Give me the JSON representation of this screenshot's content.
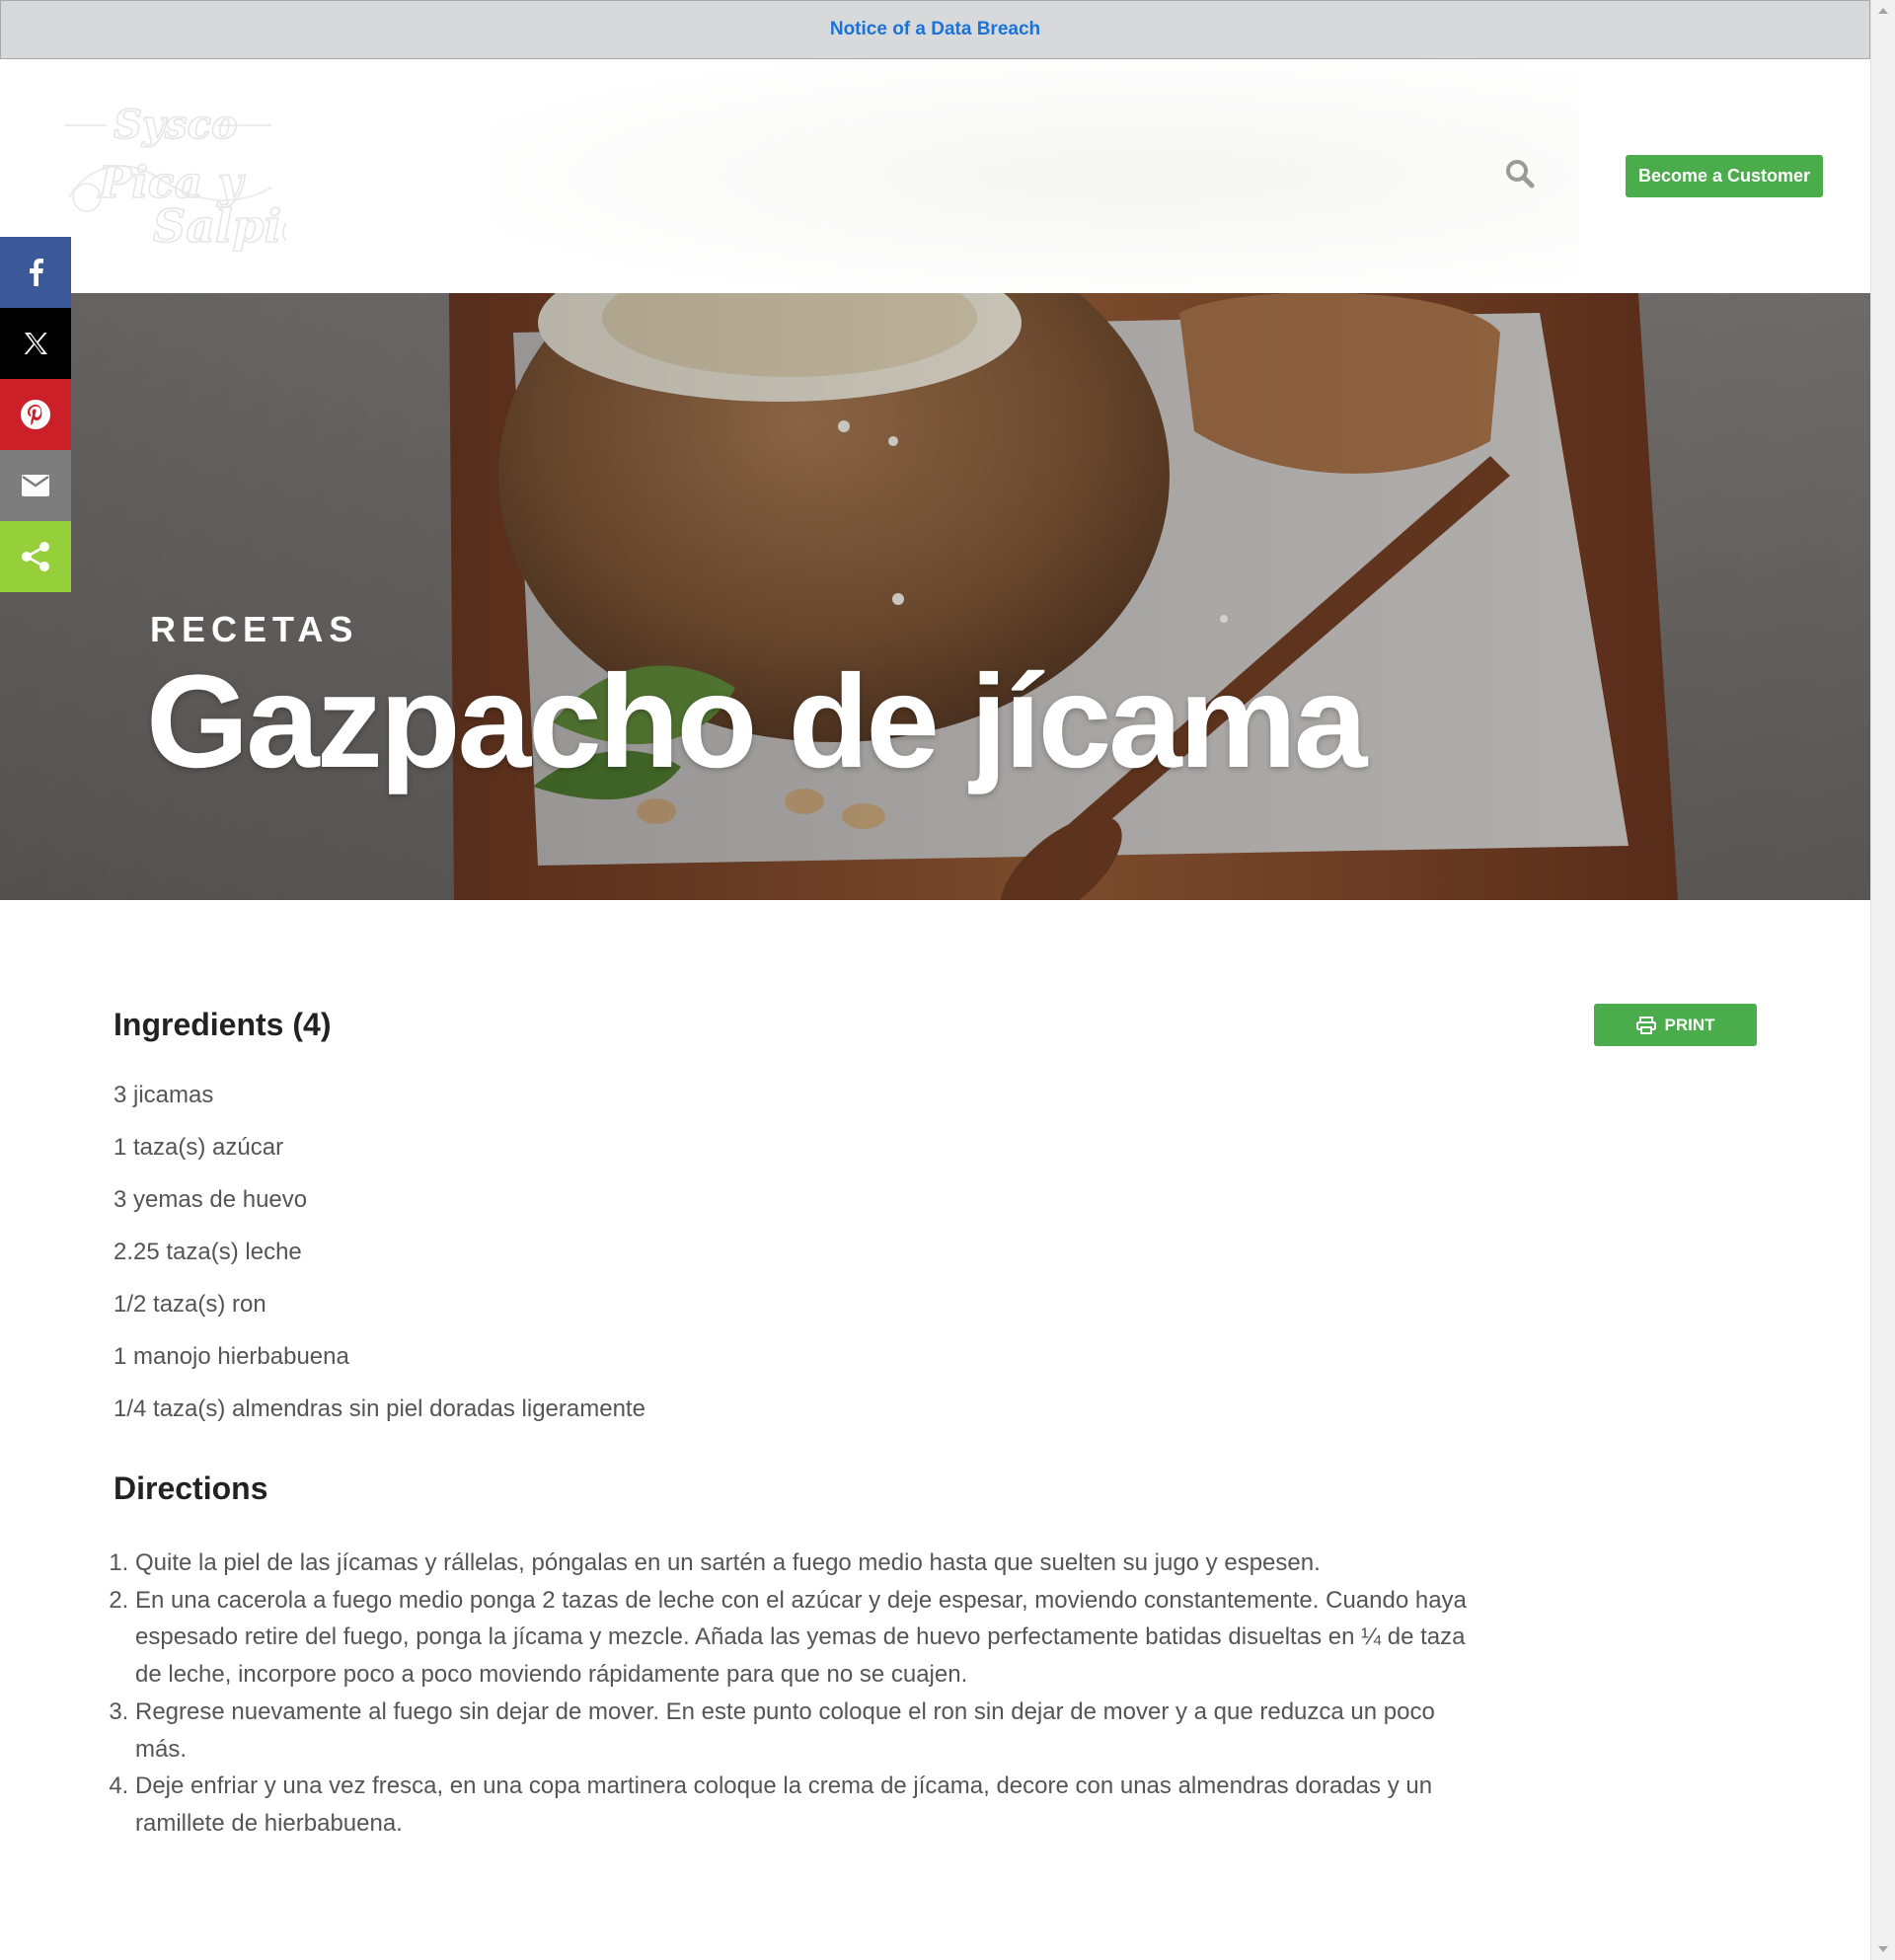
{
  "notice": {
    "link_text": "Notice of a Data Breach"
  },
  "header": {
    "logo_text_line1": "Sysco",
    "logo_text_line2": "Pica y",
    "logo_text_line3": "Salpica",
    "cta_label": "Become a Customer",
    "search_icon": "search-icon"
  },
  "share": {
    "items": [
      {
        "name": "facebook",
        "icon": "facebook-icon",
        "color": "#3b5998"
      },
      {
        "name": "x",
        "icon": "x-icon",
        "color": "#000000"
      },
      {
        "name": "pinterest",
        "icon": "pinterest-icon",
        "color": "#cb2027"
      },
      {
        "name": "email",
        "icon": "email-icon",
        "color": "#7d7d7d"
      },
      {
        "name": "share",
        "icon": "share-icon",
        "color": "#95d03a"
      }
    ]
  },
  "hero": {
    "kicker": "RECETAS",
    "title": "Gazpacho de jícama"
  },
  "recipe": {
    "ingredients_title": "Ingredients (4)",
    "print_label": "PRINT",
    "ingredients": [
      "3 jicamas",
      "1 taza(s) azúcar",
      "3 yemas de huevo",
      "2.25 taza(s) leche",
      "1/2 taza(s) ron",
      "1 manojo hierbabuena",
      "1/4 taza(s) almendras sin piel doradas ligeramente"
    ],
    "directions_title": "Directions",
    "directions": [
      "Quite la piel de las jícamas y rállelas, póngalas en un sartén a fuego medio hasta que suelten su jugo y espesen.",
      "En una cacerola a fuego medio ponga 2 tazas de leche con el azúcar y deje espesar, moviendo constantemente. Cuando haya espesado retire del fuego, ponga la jícama y mezcle. Añada las yemas de huevo perfectamente batidas disueltas en ¼ de taza de leche, incorpore poco a poco moviendo rápidamente para que no se cuajen.",
      "Regrese nuevamente al fuego sin dejar de mover. En este punto coloque el ron sin dejar de mover y a que reduzca un poco más.",
      "Deje enfriar y una vez fresca, en una copa martinera coloque la crema de jícama, decore con unas almendras doradas y un ramillete de hierbabuena."
    ]
  },
  "colors": {
    "accent_green": "#4aac4a",
    "notice_link": "#1a73d9"
  }
}
